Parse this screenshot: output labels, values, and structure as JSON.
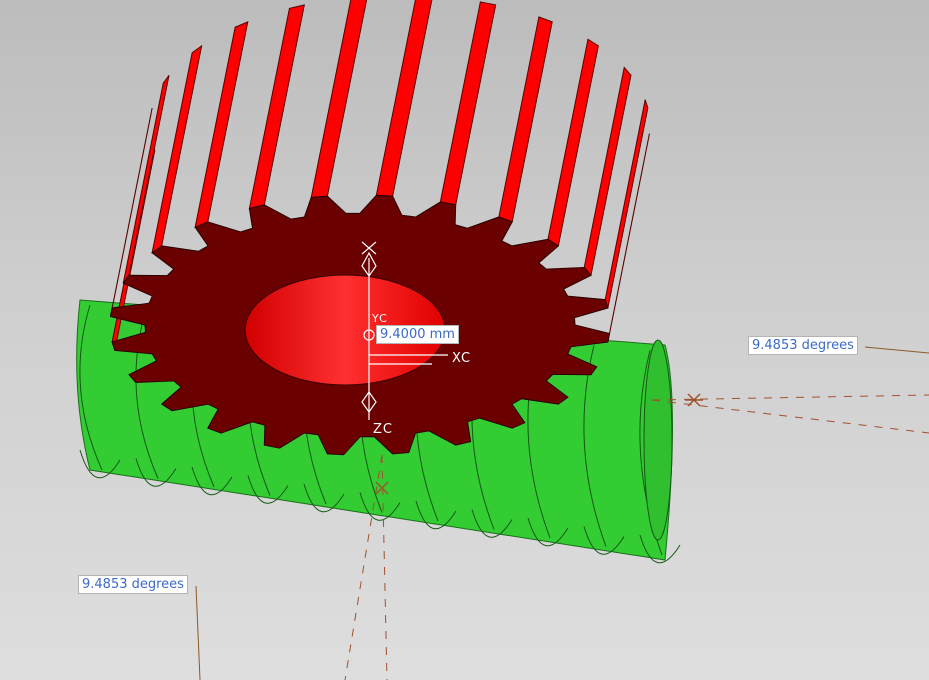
{
  "viewport": {
    "background_top": "#bcbcbc",
    "background_bottom": "#dedede"
  },
  "model": {
    "gear_color": "#ff0000",
    "gear_face_color": "#6a0000",
    "worm_color": "#33cc33",
    "gear_teeth": 24,
    "worm_thread_turns": 10
  },
  "dimensions": {
    "center_distance": "9.4000 mm",
    "helix_angle_right": "9.4853 degrees",
    "helix_angle_left": "9.4853 degrees"
  },
  "axes": {
    "x": "XC",
    "y": "YC",
    "z": "ZC"
  },
  "icons": [
    "csys-origin-icon",
    "cross-marker-icon"
  ]
}
